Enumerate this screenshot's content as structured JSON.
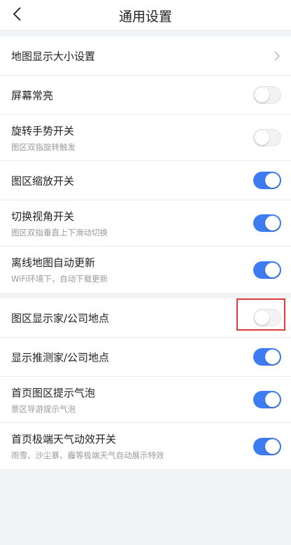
{
  "header": {
    "title": "通用设置",
    "back_icon": "chevron-left-icon"
  },
  "colors": {
    "toggle_on": "#3d7cf2",
    "toggle_off": "#f2f2f4",
    "highlight": "#e03a3a"
  },
  "group1": {
    "items": [
      {
        "label": "地图显示大小设置",
        "sub": "",
        "control": "chevron"
      },
      {
        "label": "屏幕常亮",
        "sub": "",
        "control": "toggle",
        "on": false
      },
      {
        "label": "旋转手势开关",
        "sub": "图区双指旋转触发",
        "control": "toggle",
        "on": false
      },
      {
        "label": "图区缩放开关",
        "sub": "",
        "control": "toggle",
        "on": true
      },
      {
        "label": "切换视角开关",
        "sub": "图区双指垂直上下滑动切换",
        "control": "toggle",
        "on": true
      },
      {
        "label": "离线地图自动更新",
        "sub": "WiFi环境下，自动下载更新",
        "control": "toggle",
        "on": true
      }
    ]
  },
  "group2": {
    "items": [
      {
        "label": "图区显示家/公司地点",
        "sub": "",
        "control": "toggle",
        "on": false,
        "highlighted": true
      },
      {
        "label": "显示推测家/公司地点",
        "sub": "",
        "control": "toggle",
        "on": true
      },
      {
        "label": "首页图区提示气泡",
        "sub": "景区导游提示气泡",
        "control": "toggle",
        "on": true
      },
      {
        "label": "首页极端天气动效开关",
        "sub": "雨雪、沙尘暴、霾等极端天气自动展示特效",
        "control": "toggle",
        "on": true
      }
    ]
  }
}
